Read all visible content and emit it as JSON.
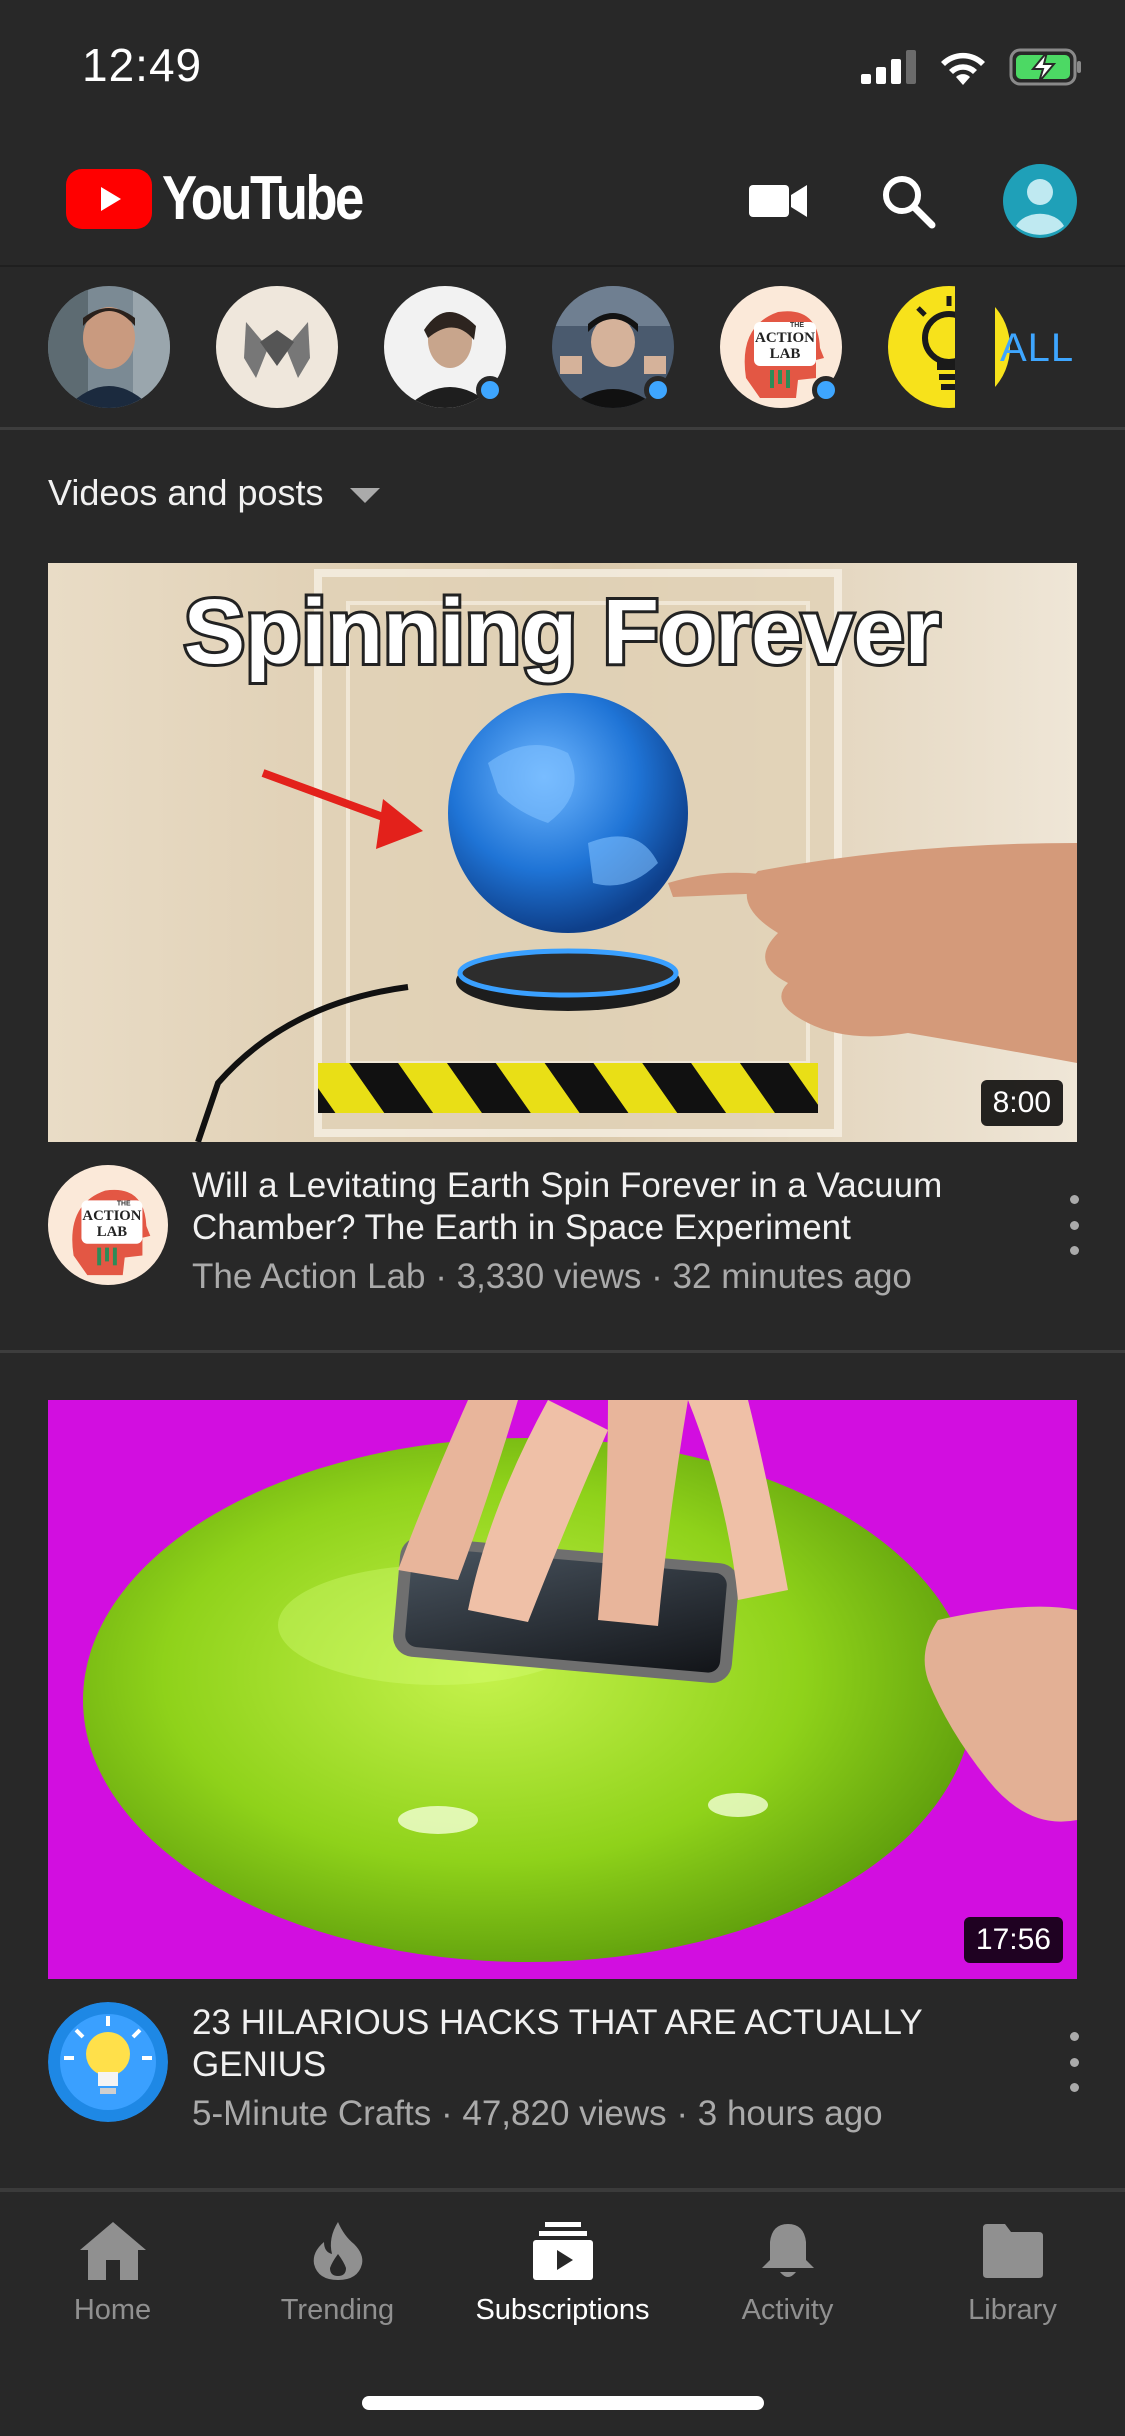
{
  "status_bar": {
    "time": "12:49"
  },
  "header": {
    "logo_text": "YouTube"
  },
  "channels": {
    "all_label": "ALL",
    "items": [
      {
        "name": "channel-1",
        "has_new": false
      },
      {
        "name": "channel-2",
        "has_new": false
      },
      {
        "name": "channel-3",
        "has_new": true
      },
      {
        "name": "channel-4",
        "has_new": true
      },
      {
        "name": "The Action Lab",
        "has_new": true,
        "logo_small": "THE",
        "logo_line1": "ACTION",
        "logo_line2": "LAB"
      },
      {
        "name": "5-Minute Crafts",
        "has_new": false
      }
    ]
  },
  "filter": {
    "label": "Videos and posts"
  },
  "videos": [
    {
      "thumb_text": "Spinning Forever",
      "duration": "8:00",
      "title": "Will a Levitating Earth Spin Forever in a Vacuum Chamber? The Earth in Space Experiment",
      "channel": "The Action Lab",
      "views": "3,330 views",
      "age": "32 minutes ago",
      "avatar_small": "THE",
      "avatar_line1": "ACTION",
      "avatar_line2": "LAB"
    },
    {
      "duration": "17:56",
      "title": "23 HILARIOUS HACKS THAT ARE ACTUALLY GENIUS",
      "channel": "5-Minute Crafts",
      "views": "47,820 views",
      "age": "3 hours ago"
    }
  ],
  "meta_separator": " · ",
  "nav": {
    "items": [
      {
        "label": "Home",
        "icon": "home-icon",
        "active": false
      },
      {
        "label": "Trending",
        "icon": "flame-icon",
        "active": false
      },
      {
        "label": "Subscriptions",
        "icon": "subscriptions-icon",
        "active": true
      },
      {
        "label": "Activity",
        "icon": "bell-icon",
        "active": false
      },
      {
        "label": "Library",
        "icon": "folder-icon",
        "active": false
      }
    ]
  },
  "colors": {
    "background": "#282828",
    "brand_red": "#ff0000",
    "accent_blue": "#3ea6ff",
    "secondary_text": "#aaaaaa"
  }
}
